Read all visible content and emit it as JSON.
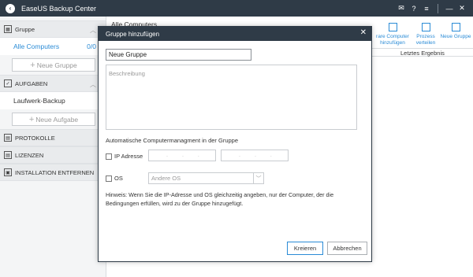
{
  "app": {
    "title": "EaseUS Backup Center",
    "logo_icon": "chevron-left-icon"
  },
  "window_controls": [
    {
      "name": "mail-icon",
      "glyph": "✉"
    },
    {
      "name": "help-icon",
      "glyph": "?"
    },
    {
      "name": "menu-icon",
      "glyph": "≡"
    },
    {
      "name": "minimize-icon",
      "glyph": "—"
    },
    {
      "name": "close-icon",
      "glyph": "✕"
    }
  ],
  "sidebar": {
    "group_header": "Gruppe",
    "all_computers": "Alle Computers",
    "all_computers_count": "0/0",
    "new_group_button": "Neue Gruppe",
    "tasks_header": "AUFGABEN",
    "drive_backup": "Laufwerk-Backup",
    "new_task_button": "Neue Aufgabe",
    "protocols": "PROTOKOLLE",
    "licenses": "LIZENZEN",
    "uninstall": "INSTALLATION ENTFERNEN"
  },
  "main": {
    "breadcrumb": "Alle Computers",
    "tools": [
      {
        "label": "rare Computer hinzufügen"
      },
      {
        "label": "Prozess verteilen"
      },
      {
        "label": "Neue Gruppe"
      }
    ],
    "column_last_result": "Letztes Ergebnis"
  },
  "dialog": {
    "title": "Gruppe hinzufügen",
    "name_value": "Neue Gruppe",
    "description_placeholder": "Beschreibung",
    "auto_management_label": "Automatische Computermanagment in der Gruppe",
    "ip_checkbox_label": "IP Adresse",
    "os_checkbox_label": "OS",
    "os_placeholder": "Andere OS",
    "hint": "Hinweis: Wenn Sie die IP-Adresse und OS gleichzeitig angeben, nur der Computer, der die Bedingungen erfüllen, wird zu der Gruppe hinzugefügt.",
    "create_button": "Kreieren",
    "cancel_button": "Abbrechen"
  },
  "colors": {
    "titlebar": "#2f3b47",
    "accent": "#2a8bd6"
  }
}
